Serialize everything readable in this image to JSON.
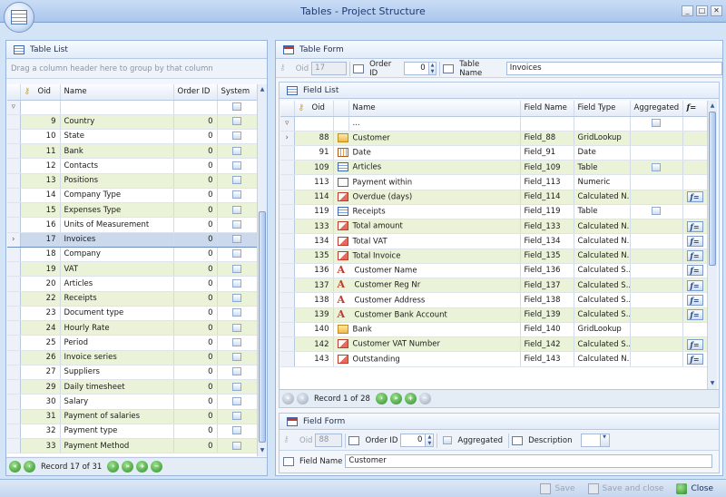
{
  "window": {
    "title": "Tables - Project Structure",
    "min": "_",
    "max": "□",
    "close": "✕"
  },
  "left": {
    "header": "Table List",
    "group_hint": "Drag a column header here to group by that column",
    "columns": [
      "Oid",
      "Name",
      "Order ID",
      "System"
    ],
    "rows": [
      {
        "oid": "9",
        "name": "Country",
        "order": "0"
      },
      {
        "oid": "10",
        "name": "State",
        "order": "0"
      },
      {
        "oid": "11",
        "name": "Bank",
        "order": "0"
      },
      {
        "oid": "12",
        "name": "Contacts",
        "order": "0"
      },
      {
        "oid": "13",
        "name": "Positions",
        "order": "0"
      },
      {
        "oid": "14",
        "name": "Company Type",
        "order": "0"
      },
      {
        "oid": "15",
        "name": "Expenses Type",
        "order": "0"
      },
      {
        "oid": "16",
        "name": "Units of Measurement",
        "order": "0"
      },
      {
        "oid": "17",
        "name": "Invoices",
        "order": "0",
        "selected": true
      },
      {
        "oid": "18",
        "name": "Company",
        "order": "0"
      },
      {
        "oid": "19",
        "name": "VAT",
        "order": "0"
      },
      {
        "oid": "20",
        "name": "Articles",
        "order": "0"
      },
      {
        "oid": "22",
        "name": "Receipts",
        "order": "0"
      },
      {
        "oid": "23",
        "name": "Document type",
        "order": "0"
      },
      {
        "oid": "24",
        "name": "Hourly Rate",
        "order": "0"
      },
      {
        "oid": "25",
        "name": "Period",
        "order": "0"
      },
      {
        "oid": "26",
        "name": "Invoice series",
        "order": "0"
      },
      {
        "oid": "27",
        "name": "Suppliers",
        "order": "0"
      },
      {
        "oid": "29",
        "name": "Daily timesheet",
        "order": "0"
      },
      {
        "oid": "30",
        "name": "Salary",
        "order": "0"
      },
      {
        "oid": "31",
        "name": "Payment of salaries",
        "order": "0"
      },
      {
        "oid": "32",
        "name": "Payment type",
        "order": "0"
      },
      {
        "oid": "33",
        "name": "Payment Method",
        "order": "0"
      }
    ],
    "record": "Record 17 of 31"
  },
  "form": {
    "header": "Table Form",
    "oid_label": "Oid",
    "oid_value": "17",
    "order_label": "Order ID",
    "order_value": "0",
    "name_label": "Table Name",
    "name_value": "Invoices"
  },
  "fields": {
    "header": "Field List",
    "columns": [
      "Oid",
      "Name",
      "Field Name",
      "Field Type",
      "Aggregated"
    ],
    "filter_name": "...",
    "rows": [
      {
        "oid": "88",
        "icon": "lookup-icon",
        "name": "Customer",
        "field": "Field_88",
        "type": "GridLookup",
        "agg": false,
        "fx": false
      },
      {
        "oid": "91",
        "icon": "date-icon",
        "name": "Date",
        "field": "Field_91",
        "type": "Date",
        "agg": false,
        "fx": false
      },
      {
        "oid": "109",
        "icon": "table-icon",
        "name": "Articles",
        "field": "Field_109",
        "type": "Table",
        "agg": true,
        "fx": false
      },
      {
        "oid": "113",
        "icon": "numeric-icon",
        "name": "Payment within",
        "field": "Field_113",
        "type": "Numeric",
        "agg": false,
        "fx": false
      },
      {
        "oid": "114",
        "icon": "calculated-icon",
        "name": "Overdue (days)",
        "field": "Field_114",
        "type": "Calculated N...",
        "agg": false,
        "fx": true
      },
      {
        "oid": "119",
        "icon": "table-icon",
        "name": "Receipts",
        "field": "Field_119",
        "type": "Table",
        "agg": true,
        "fx": false
      },
      {
        "oid": "133",
        "icon": "calculated-icon",
        "name": "Total amount",
        "field": "Field_133",
        "type": "Calculated N...",
        "agg": false,
        "fx": true
      },
      {
        "oid": "134",
        "icon": "calculated-icon",
        "name": "Total VAT",
        "field": "Field_134",
        "type": "Calculated N...",
        "agg": false,
        "fx": true
      },
      {
        "oid": "135",
        "icon": "calculated-icon",
        "name": "Total Invoice",
        "field": "Field_135",
        "type": "Calculated N...",
        "agg": false,
        "fx": true
      },
      {
        "oid": "136",
        "icon": "text-icon",
        "name": "Customer Name",
        "field": "Field_136",
        "type": "Calculated S...",
        "agg": false,
        "fx": true
      },
      {
        "oid": "137",
        "icon": "text-icon",
        "name": "Customer Reg Nr",
        "field": "Field_137",
        "type": "Calculated S...",
        "agg": false,
        "fx": true
      },
      {
        "oid": "138",
        "icon": "text-icon",
        "name": "Customer Address",
        "field": "Field_138",
        "type": "Calculated S...",
        "agg": false,
        "fx": true
      },
      {
        "oid": "139",
        "icon": "text-icon",
        "name": "Customer Bank Account",
        "field": "Field_139",
        "type": "Calculated S...",
        "agg": false,
        "fx": true
      },
      {
        "oid": "140",
        "icon": "lookup-icon",
        "name": "Bank",
        "field": "Field_140",
        "type": "GridLookup",
        "agg": false,
        "fx": false
      },
      {
        "oid": "142",
        "icon": "calculated-icon",
        "name": "Customer VAT Number",
        "field": "Field_142",
        "type": "Calculated S...",
        "agg": false,
        "fx": true
      },
      {
        "oid": "143",
        "icon": "calculated-icon",
        "name": "Outstanding",
        "field": "Field_143",
        "type": "Calculated N...",
        "agg": false,
        "fx": true
      }
    ],
    "record": "Record 1 of 28"
  },
  "field_form": {
    "header": "Field Form",
    "oid_label": "Oid",
    "oid_value": "88",
    "order_label": "Order ID",
    "order_value": "0",
    "agg_label": "Aggregated",
    "desc_label": "Description",
    "name_label": "Field Name",
    "name_value": "Customer"
  },
  "buttons": {
    "save": "Save",
    "save_close": "Save and close",
    "close": "Close"
  },
  "fx_label": "f="
}
